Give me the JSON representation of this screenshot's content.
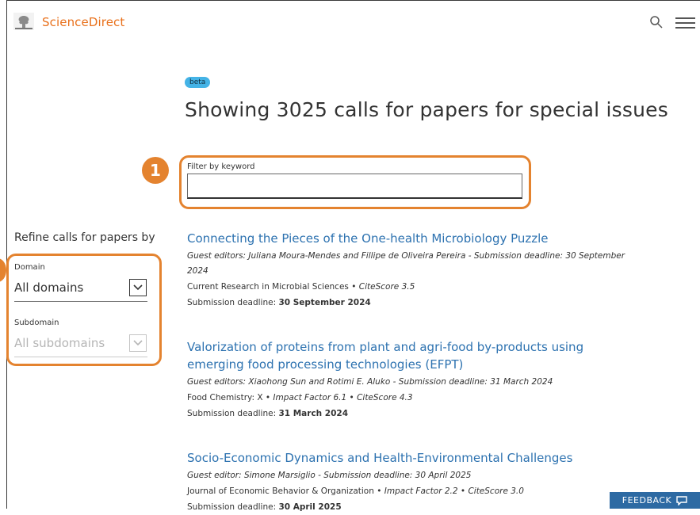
{
  "header": {
    "brand": "ScienceDirect",
    "icons": {
      "logo": "elsevier-tree-logo",
      "search": "search-icon",
      "menu": "hamburger-menu-icon"
    }
  },
  "main": {
    "beta_label": "beta",
    "title": "Showing 3025 calls for papers for special issues",
    "filter": {
      "label": "Filter by keyword",
      "value": "",
      "placeholder": ""
    },
    "annotation_number": "1"
  },
  "sidebar": {
    "heading": "Refine calls for papers by",
    "domain": {
      "label": "Domain",
      "value": "All domains"
    },
    "subdomain": {
      "label": "Subdomain",
      "value": "All subdomains"
    }
  },
  "results": [
    {
      "title": "Connecting the Pieces of the One-health Microbiology Puzzle",
      "editors": "Guest editors: Juliana Moura-Mendes and Fillipe de Oliveira Pereira - Submission deadline: 30 September 2024",
      "journal": "Current Research in Microbial Sciences",
      "metrics": "CiteScore 3.5",
      "deadline_label": "Submission deadline:",
      "deadline": "30 September 2024"
    },
    {
      "title": "Valorization of proteins from plant and agri-food by-products using emerging food processing technologies (EFPT)",
      "editors": "Guest editors: Xiaohong Sun and Rotimi E. Aluko - Submission deadline: 31 March 2024",
      "journal": "Food Chemistry: X",
      "metrics": "Impact Factor 6.1 • CiteScore 4.3",
      "deadline_label": "Submission deadline:",
      "deadline": "31 March 2024"
    },
    {
      "title": "Socio-Economic Dynamics and Health-Environmental Challenges",
      "editors": "Guest editor: Simone Marsiglio - Submission deadline: 30 April 2025",
      "journal": "Journal of Economic Behavior & Organization",
      "metrics": "Impact Factor 2.2 • CiteScore 3.0",
      "deadline_label": "Submission deadline:",
      "deadline": "30 April 2025"
    }
  ],
  "feedback": {
    "label": "FEEDBACK",
    "icon": "speech-bubble-icon"
  },
  "colors": {
    "brand": "#e9711c",
    "link": "#2d72b0",
    "highlight": "#e4832f",
    "beta": "#44b3e6",
    "feedback": "#2d6aa3"
  }
}
